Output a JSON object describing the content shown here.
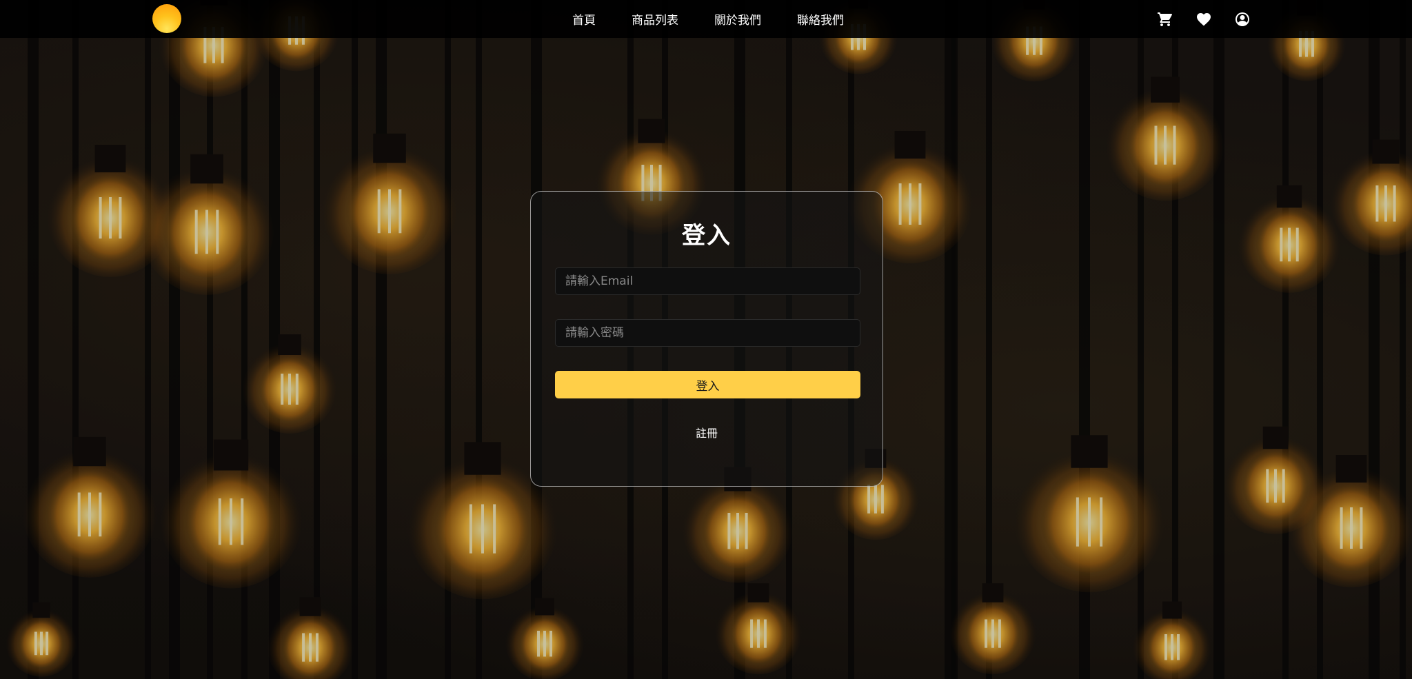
{
  "nav": {
    "links": [
      "首頁",
      "商品列表",
      "關於我們",
      "聯絡我們"
    ],
    "icons": [
      "cart-icon",
      "heart-icon",
      "user-icon"
    ]
  },
  "login": {
    "title": "登入",
    "email_placeholder": "請輸入Email",
    "password_placeholder": "請輸入密碼",
    "submit_label": "登入",
    "register_label": "註冊"
  },
  "colors": {
    "navbar_bg": "#000000",
    "accent": "#ffcf48",
    "logo": "#ffb21a"
  }
}
